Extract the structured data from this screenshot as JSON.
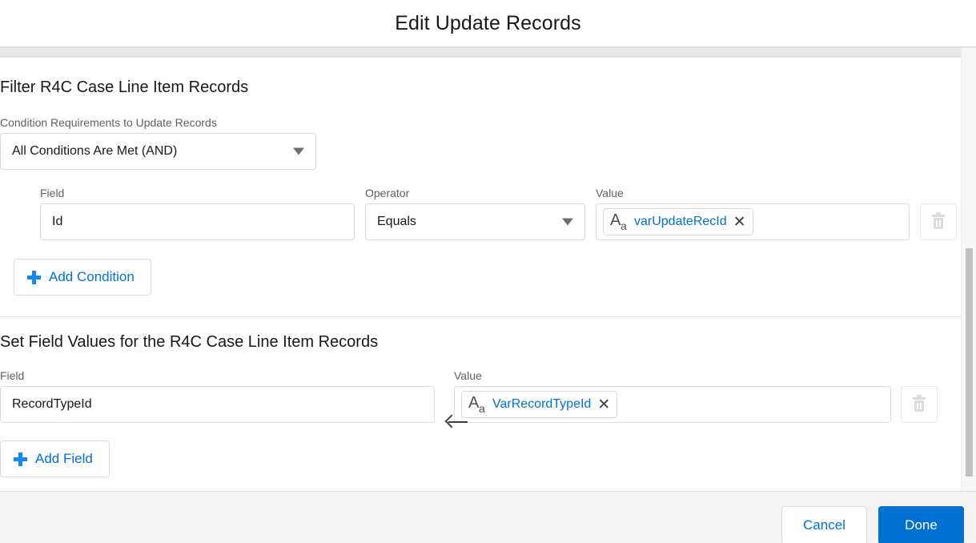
{
  "header": {
    "title": "Edit Update Records"
  },
  "filter_section": {
    "heading": "Filter R4C Case Line Item Records",
    "condition_label": "Condition Requirements to Update Records",
    "condition_logic": "All Conditions Are Met (AND)",
    "columns": {
      "field": "Field",
      "operator": "Operator",
      "value": "Value"
    },
    "rows": [
      {
        "field": "Id",
        "operator": "Equals",
        "value_pill": "varUpdateRecId",
        "value_pill_icon": "text-type-icon",
        "remove_pill_icon": "close-icon",
        "delete_icon": "trash-icon",
        "delete_disabled": true
      }
    ],
    "add_condition_label": "Add Condition",
    "add_condition_icon": "plus-icon"
  },
  "assignment_section": {
    "heading": "Set Field Values for the R4C Case Line Item Records",
    "columns": {
      "field": "Field",
      "value": "Value"
    },
    "rows": [
      {
        "field": "RecordTypeId",
        "arrow_icon": "left-arrow-icon",
        "value_pill": "VarRecordTypeId",
        "value_pill_icon": "text-type-icon",
        "remove_pill_icon": "close-icon",
        "delete_icon": "trash-icon",
        "delete_disabled": true
      }
    ],
    "add_field_label": "Add Field",
    "add_field_icon": "plus-icon"
  },
  "footer": {
    "cancel_label": "Cancel",
    "done_label": "Done"
  },
  "colors": {
    "brand": "#0070d2",
    "link": "#0070d2",
    "plus": "#1589ee",
    "border": "#dddbda",
    "footer_bg": "#f4f3f2",
    "text": "#16191c",
    "label": "#5b6268",
    "disabled_icon": "#dcdcdc"
  }
}
